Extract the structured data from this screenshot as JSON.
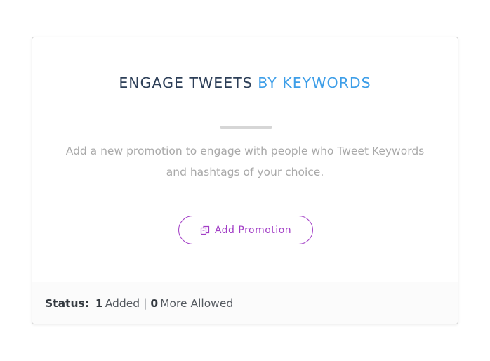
{
  "card": {
    "title_main": "ENGAGE TWEETS",
    "title_accent": "BY KEYWORDS",
    "description": "Add a new promotion to engage with people who Tweet Keywords and hashtags of your choice.",
    "button": {
      "label": "Add Promotion",
      "icon": "copy-icon"
    },
    "footer": {
      "status_label": "Status:",
      "added_count": "1",
      "added_label": "Added",
      "separator": "|",
      "allowed_count": "0",
      "allowed_label": "More Allowed"
    }
  },
  "colors": {
    "title": "#2c3e57",
    "accent": "#3d9ee8",
    "button": "#a23ec6",
    "description": "#a9a9a9"
  }
}
